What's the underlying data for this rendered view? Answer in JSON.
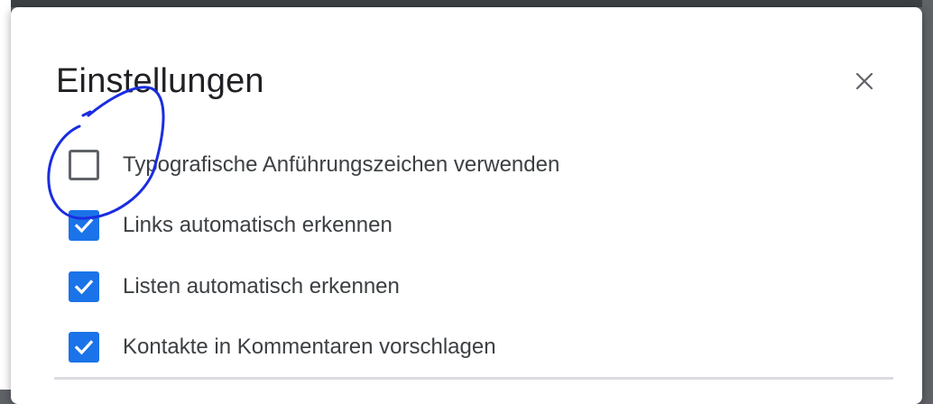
{
  "dialog": {
    "title": "Einstellungen",
    "close_icon": "close-icon",
    "options": [
      {
        "label": "Typografische Anführungszeichen verwenden",
        "checked": false
      },
      {
        "label": "Links automatisch erkennen",
        "checked": true
      },
      {
        "label": "Listen automatisch erkennen",
        "checked": true
      },
      {
        "label": "Kontakte in Kommentaren vorschlagen",
        "checked": true
      }
    ]
  },
  "colors": {
    "accent": "#1a73e8",
    "annotation": "#1a2de0"
  }
}
